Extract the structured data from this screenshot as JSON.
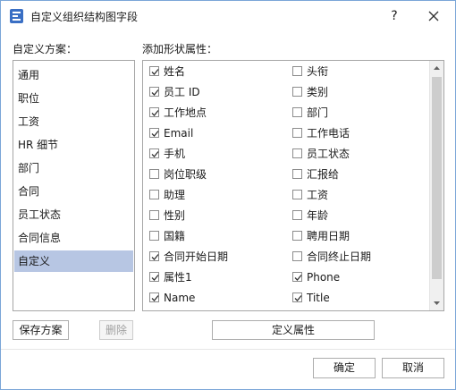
{
  "window": {
    "title": "自定义组织结构图字段",
    "help_label": "?",
    "accent_color": "#3a6fc4"
  },
  "left": {
    "header": "自定义方案：",
    "items": [
      "通用",
      "职位",
      "工资",
      "HR 细节",
      "部门",
      "合同",
      "员工状态",
      "合同信息",
      "自定义"
    ],
    "selected": "自定义",
    "selected_color": "#b7c6e3",
    "save_label": "保存方案",
    "delete_label": "删除"
  },
  "right": {
    "header": "添加形状属性：",
    "left_column": [
      {
        "label": "姓名",
        "checked": true
      },
      {
        "label": "员工 ID",
        "checked": true
      },
      {
        "label": "工作地点",
        "checked": true
      },
      {
        "label": "Email",
        "checked": true
      },
      {
        "label": "手机",
        "checked": true
      },
      {
        "label": "岗位职级",
        "checked": false
      },
      {
        "label": "助理",
        "checked": false
      },
      {
        "label": "性别",
        "checked": false
      },
      {
        "label": "国籍",
        "checked": false
      },
      {
        "label": "合同开始日期",
        "checked": true
      },
      {
        "label": "属性1",
        "checked": true
      },
      {
        "label": "Name",
        "checked": true
      }
    ],
    "right_column": [
      {
        "label": "头衔",
        "checked": false
      },
      {
        "label": "类别",
        "checked": false
      },
      {
        "label": "部门",
        "checked": false
      },
      {
        "label": "工作电话",
        "checked": false
      },
      {
        "label": "员工状态",
        "checked": false
      },
      {
        "label": "汇报给",
        "checked": false
      },
      {
        "label": "工资",
        "checked": false
      },
      {
        "label": "年龄",
        "checked": false
      },
      {
        "label": "聘用日期",
        "checked": false
      },
      {
        "label": "合同终止日期",
        "checked": false
      },
      {
        "label": "Phone",
        "checked": true
      },
      {
        "label": "Title",
        "checked": true
      }
    ],
    "define_label": "定义属性"
  },
  "footer": {
    "ok_label": "确定",
    "cancel_label": "取消"
  }
}
